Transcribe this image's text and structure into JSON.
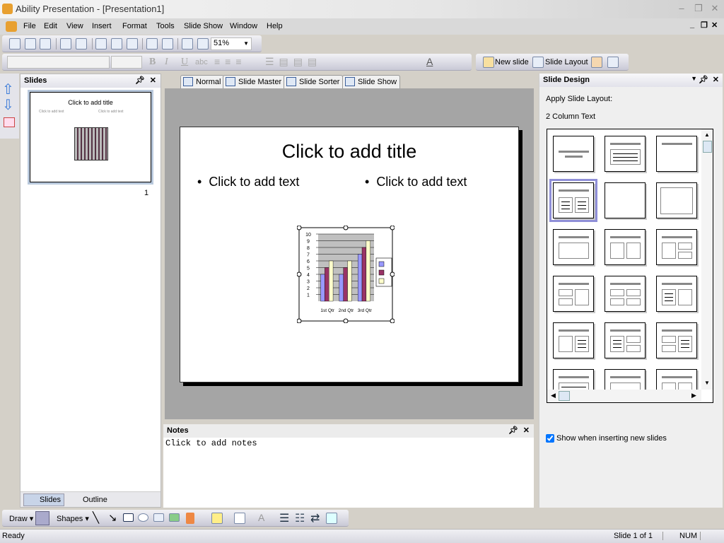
{
  "window": {
    "title": "Ability Presentation - [Presentation1]"
  },
  "menu": [
    "File",
    "Edit",
    "View",
    "Insert",
    "Format",
    "Tools",
    "Slide Show",
    "Window",
    "Help"
  ],
  "toolbar": {
    "zoom": "51%",
    "new_slide": "New slide",
    "slide_layout": "Slide Layout",
    "font_name": "",
    "font_size": ""
  },
  "slides_panel": {
    "title": "Slides",
    "slide_number": "1",
    "tabs": [
      "Slides",
      "Outline"
    ],
    "thumb_title": "Click to add title",
    "thumb_text": "Click to add text"
  },
  "view_tabs": [
    "Normal",
    "Slide Master",
    "Slide Sorter",
    "Slide Show"
  ],
  "slide": {
    "title": "Click to add title",
    "col1": "Click to add text",
    "col2": "Click to add text"
  },
  "chart_data": {
    "type": "bar",
    "categories": [
      "1st Qtr",
      "2nd Qtr",
      "3rd Qtr"
    ],
    "series": [
      {
        "values": [
          4,
          4,
          7
        ],
        "color": "#9999ff"
      },
      {
        "values": [
          5,
          5,
          8
        ],
        "color": "#993366"
      },
      {
        "values": [
          6,
          6,
          9
        ],
        "color": "#ffffcc"
      }
    ],
    "yticks": [
      "1",
      "2",
      "3",
      "4",
      "5",
      "6",
      "7",
      "8",
      "9",
      "10"
    ],
    "ylim": [
      0,
      10
    ],
    "grid": true,
    "legend": "right"
  },
  "notes": {
    "title": "Notes",
    "placeholder": "Click to add notes"
  },
  "design_panel": {
    "title": "Slide Design",
    "apply_label": "Apply Slide Layout:",
    "selected_layout": "2 Column Text",
    "layouts": [
      "title",
      "title-text",
      "title-only",
      "two-column-text",
      "blank",
      "content",
      "title-content",
      "title-two-content",
      "content-two-stacked",
      "two-stacked-content",
      "four-content",
      "text-content",
      "content-text",
      "text-two-stacked",
      "two-stacked-text",
      "title-wide-text",
      "title-content",
      "title-two-content"
    ],
    "selected_index": 3,
    "show_checkbox": "Show when inserting new slides",
    "show_checked": true
  },
  "draw_toolbar": {
    "draw": "Draw",
    "shapes": "Shapes"
  },
  "status": {
    "left": "Ready",
    "slide": "Slide 1 of 1",
    "num": "NUM"
  }
}
